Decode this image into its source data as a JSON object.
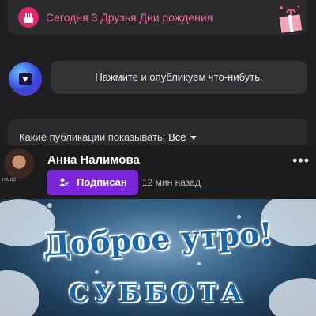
{
  "birthday": {
    "text": "Сегодня 3 Друзья Дни рождения"
  },
  "composer": {
    "prompt": "Нажмите и опубликуем что-нибуть."
  },
  "feed_filter": {
    "label": "Какие публикации показывать:",
    "value": "Все"
  },
  "post": {
    "author": "Анна Налимова",
    "avatar_caption": "на ое",
    "subscribe_label": "Подписан",
    "time": "12 мин назад",
    "more": "•••",
    "image_text_1": "Доброе утро!",
    "image_text_2": "СУББОТА"
  },
  "colors": {
    "accent": "#7c26d9",
    "birthday": "#f06b9a",
    "background": "#1f1f21"
  }
}
